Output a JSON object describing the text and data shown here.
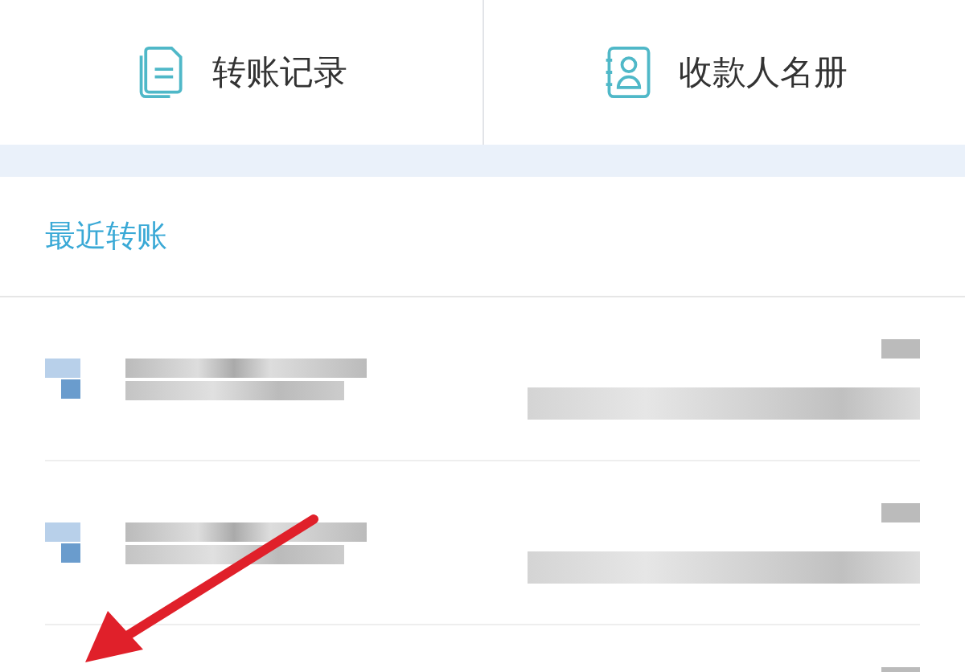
{
  "actions": [
    {
      "label": "转账记录",
      "kind": "document"
    },
    {
      "label": "收款人名册",
      "kind": "contacts"
    }
  ],
  "recent": {
    "title": "最近转账",
    "rows": [
      {
        "kind": "pixelated"
      },
      {
        "kind": "pixelated"
      },
      {
        "kind": "pixelated"
      }
    ]
  },
  "annotation": {
    "kind": "arrow"
  }
}
